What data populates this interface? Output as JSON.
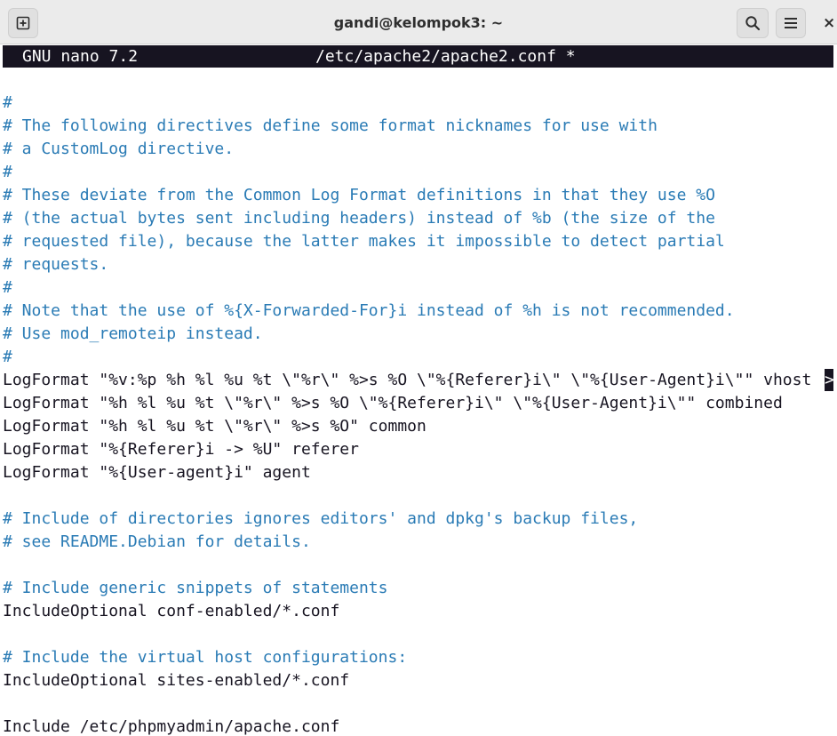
{
  "window": {
    "title": "gandi@kelompok3: ~",
    "buttons": {
      "new_tab_icon": "new-tab-icon",
      "search_icon": "search-icon",
      "menu_icon": "hamburger-menu-icon",
      "close_icon": "close-icon",
      "close_glyph": "×"
    }
  },
  "nano": {
    "version": "GNU nano 7.2",
    "filename": "/etc/apache2/apache2.conf *",
    "overflow_marker": ">"
  },
  "editor": {
    "lines": [
      "#",
      "# The following directives define some format nicknames for use with",
      "# a CustomLog directive.",
      "#",
      "# These deviate from the Common Log Format definitions in that they use %O",
      "# (the actual bytes sent including headers) instead of %b (the size of the",
      "# requested file), because the latter makes it impossible to detect partial",
      "# requests.",
      "#",
      "# Note that the use of %{X-Forwarded-For}i instead of %h is not recommended.",
      "# Use mod_remoteip instead.",
      "#",
      "LogFormat \"%v:%p %h %l %u %t \\\"%r\\\" %>s %O \\\"%{Referer}i\\\" \\\"%{User-Agent}i\\\"\" vhost",
      "LogFormat \"%h %l %u %t \\\"%r\\\" %>s %O \\\"%{Referer}i\\\" \\\"%{User-Agent}i\\\"\" combined",
      "LogFormat \"%h %l %u %t \\\"%r\\\" %>s %O\" common",
      "LogFormat \"%{Referer}i -> %U\" referer",
      "LogFormat \"%{User-agent}i\" agent",
      "",
      "# Include of directories ignores editors' and dpkg's backup files,",
      "# see README.Debian for details.",
      "",
      "# Include generic snippets of statements",
      "IncludeOptional conf-enabled/*.conf",
      "",
      "# Include the virtual host configurations:",
      "IncludeOptional sites-enabled/*.conf",
      "",
      "Include /etc/phpmyadmin/apache.conf"
    ]
  },
  "colors": {
    "comment": "#2a7bb5",
    "text": "#171421",
    "header_bg": "#171421",
    "header_fg": "#ffffff",
    "titlebar_bg": "#ebebeb"
  }
}
